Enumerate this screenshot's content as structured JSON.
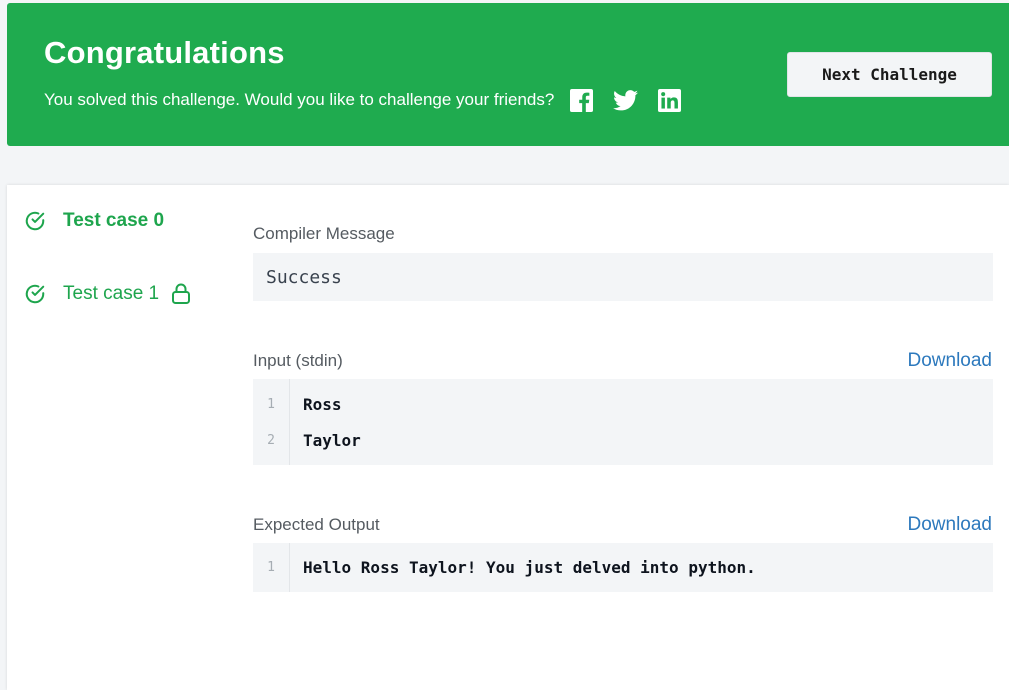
{
  "banner": {
    "title": "Congratulations",
    "subtitle": "You solved this challenge. Would you like to challenge your friends?",
    "social_icons": [
      "facebook-icon",
      "twitter-icon",
      "linkedin-icon"
    ],
    "next_button_label": "Next Challenge",
    "color": "#1fab4f"
  },
  "sidebar": {
    "items": [
      {
        "label": "Test case 0",
        "status": "passed",
        "active": true,
        "locked": false
      },
      {
        "label": "Test case 1",
        "status": "passed",
        "active": false,
        "locked": true
      }
    ],
    "accent_color": "#1ea54d"
  },
  "compiler": {
    "label": "Compiler Message",
    "message": "Success"
  },
  "input": {
    "label": "Input (stdin)",
    "download_label": "Download",
    "lines": [
      {
        "num": "1",
        "text": "Ross"
      },
      {
        "num": "2",
        "text": "Taylor"
      }
    ]
  },
  "expected": {
    "label": "Expected Output",
    "download_label": "Download",
    "lines": [
      {
        "num": "1",
        "text": "Hello Ross Taylor! You just delved into python."
      }
    ]
  },
  "colors": {
    "link": "#2d79bd",
    "code_bg": "#f3f5f7"
  }
}
